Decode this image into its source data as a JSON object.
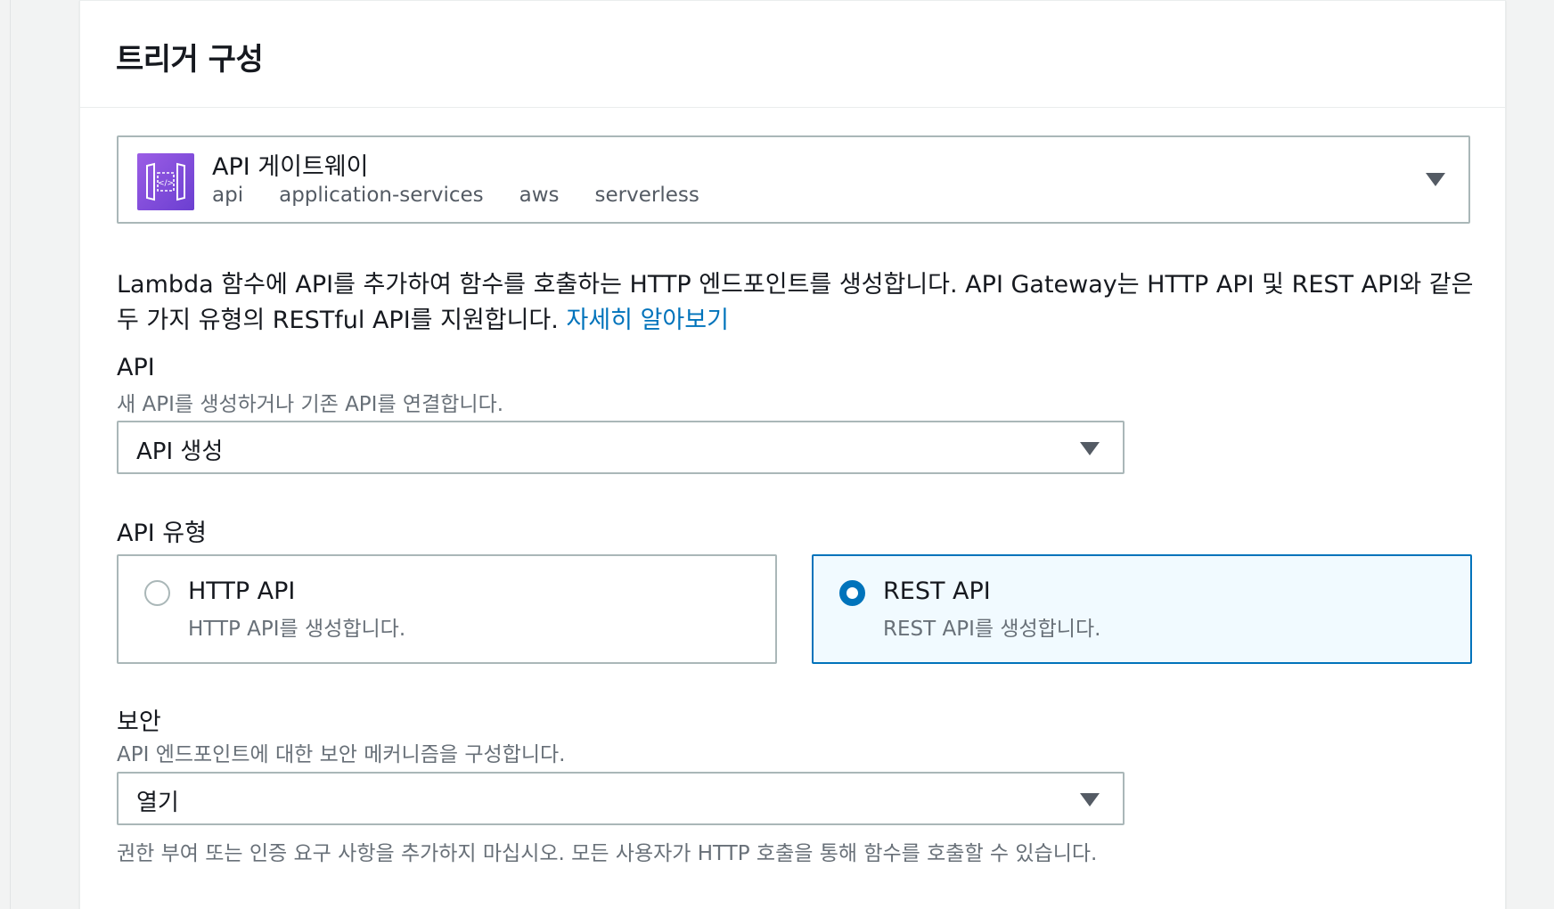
{
  "panel": {
    "title": "트리거 구성"
  },
  "trigger": {
    "service_name": "API 게이트웨이",
    "tags": [
      "api",
      "application-services",
      "aws",
      "serverless"
    ],
    "icon": "api-gateway-icon",
    "icon_color": "#8c4fff"
  },
  "description": {
    "text": "Lambda 함수에 API를 추가하여 함수를 호출하는 HTTP 엔드포인트를 생성합니다. API Gateway는 HTTP API 및 REST API와 같은 두 가지 유형의 RESTful API를 지원합니다.",
    "link": "자세히 알아보기"
  },
  "api_field": {
    "label": "API",
    "description": "새 API를 생성하거나 기존 API를 연결합니다.",
    "value": "API 생성"
  },
  "api_type": {
    "label": "API 유형",
    "options": [
      {
        "title": "HTTP API",
        "description": "HTTP API를 생성합니다.",
        "selected": false
      },
      {
        "title": "REST API",
        "description": "REST API를 생성합니다.",
        "selected": true
      }
    ]
  },
  "security": {
    "label": "보안",
    "description": "API 엔드포인트에 대한 보안 메커니즘을 구성합니다.",
    "value": "열기",
    "constraint": "권한 부여 또는 인증 요구 사항을 추가하지 마십시오. 모든 사용자가 HTTP 호출을 통해 함수를 호출할 수 있습니다."
  },
  "colors": {
    "accent": "#0073bb",
    "border": "#aab7b8",
    "selected_bg": "#f1faff"
  }
}
